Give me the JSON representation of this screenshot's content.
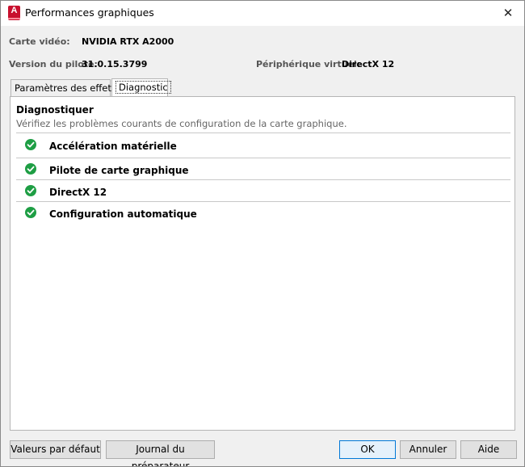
{
  "window": {
    "title": "Performances graphiques",
    "app_icon_letter": "A"
  },
  "info": {
    "card_label": "Carte vidéo:",
    "card_value": "NVIDIA RTX A2000",
    "driver_label": "Version du pilote:",
    "driver_value": "31.0.15.3799",
    "virtual_label": "Périphérique virtuel:",
    "virtual_value": "DirectX 12"
  },
  "tabs": [
    {
      "label": "Paramètres des effets",
      "active": false
    },
    {
      "label": "Diagnostic",
      "active": true
    }
  ],
  "diagnostic": {
    "title": "Diagnostiquer",
    "description": "Vérifiez les problèmes courants de configuration de la carte graphique.",
    "items": [
      {
        "label": "Accélération matérielle",
        "status": "ok"
      },
      {
        "label": "Pilote de carte graphique",
        "status": "ok"
      },
      {
        "label": "DirectX 12",
        "status": "ok"
      },
      {
        "label": "Configuration automatique",
        "status": "ok"
      }
    ]
  },
  "buttons": {
    "defaults": "Valeurs par défaut",
    "journal": "Journal du préparateur",
    "ok": "OK",
    "cancel": "Annuler",
    "help": "Aide"
  },
  "colors": {
    "accent": "#0078d7",
    "success": "#1e9e44",
    "brand": "#c8102e"
  }
}
